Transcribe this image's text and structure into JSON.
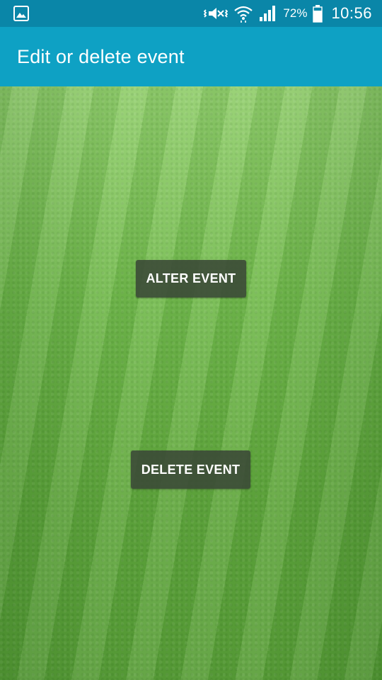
{
  "status_bar": {
    "battery_percent": "72%",
    "time": "10:56",
    "icons": [
      "image-notification-icon",
      "vibrate-mute-icon",
      "wifi-icon",
      "signal-icon",
      "battery-icon"
    ]
  },
  "app_bar": {
    "title": "Edit or delete event"
  },
  "actions": {
    "alter_label": "ALTER EVENT",
    "delete_label": "DELETE EVENT"
  },
  "colors": {
    "status_bar": "#0a86a8",
    "app_bar": "#0ea1c4",
    "button_bg": "#3a4837"
  }
}
